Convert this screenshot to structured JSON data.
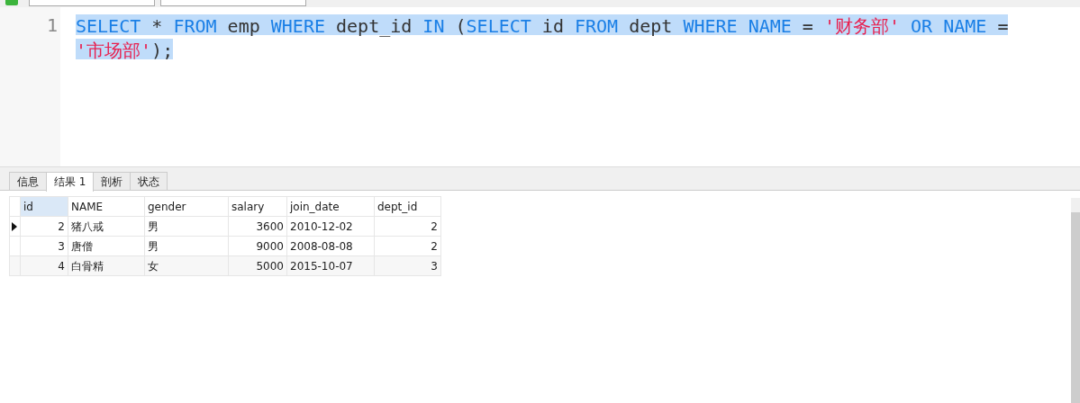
{
  "editor": {
    "lines": [
      {
        "number": "1",
        "selected": true,
        "tokens": [
          {
            "kind": "keyword",
            "text": "SELECT"
          },
          {
            "kind": "plain",
            "text": " * "
          },
          {
            "kind": "keyword",
            "text": "FROM"
          },
          {
            "kind": "plain",
            "text": " emp "
          },
          {
            "kind": "keyword",
            "text": "WHERE"
          },
          {
            "kind": "plain",
            "text": " dept_id "
          },
          {
            "kind": "keyword",
            "text": "IN"
          },
          {
            "kind": "plain",
            "text": " ("
          },
          {
            "kind": "keyword",
            "text": "SELECT"
          },
          {
            "kind": "plain",
            "text": " id "
          },
          {
            "kind": "keyword",
            "text": "FROM"
          },
          {
            "kind": "plain",
            "text": " dept "
          },
          {
            "kind": "keyword",
            "text": "WHERE NAME"
          },
          {
            "kind": "plain",
            "text": " = "
          },
          {
            "kind": "string",
            "text": "'财务部'"
          },
          {
            "kind": "keyword",
            "text": " OR NAME"
          },
          {
            "kind": "plain",
            "text": " ="
          }
        ]
      },
      {
        "selected": true,
        "tokens": [
          {
            "kind": "string",
            "text": "'市场部'"
          },
          {
            "kind": "plain",
            "text": ");"
          }
        ]
      }
    ]
  },
  "result_tabs": [
    {
      "label": "信息",
      "selected": false
    },
    {
      "label": "结果 1",
      "selected": true
    },
    {
      "label": "剖析",
      "selected": false
    },
    {
      "label": "状态",
      "selected": false
    }
  ],
  "table": {
    "columns": [
      {
        "label": "id",
        "numeric": true,
        "highlighted": true
      },
      {
        "label": "NAME",
        "numeric": false,
        "highlighted": false
      },
      {
        "label": "gender",
        "numeric": false,
        "highlighted": false
      },
      {
        "label": "salary",
        "numeric": true,
        "highlighted": false
      },
      {
        "label": "join_date",
        "numeric": false,
        "highlighted": false
      },
      {
        "label": "dept_id",
        "numeric": true,
        "highlighted": false
      }
    ],
    "rows": [
      {
        "current": true,
        "cells": [
          "2",
          "猪八戒",
          "男",
          "3600",
          "2010-12-02",
          "2"
        ]
      },
      {
        "current": false,
        "cells": [
          "3",
          "唐僧",
          "男",
          "9000",
          "2008-08-08",
          "2"
        ]
      },
      {
        "current": false,
        "cells": [
          "4",
          "白骨精",
          "女",
          "5000",
          "2015-10-07",
          "3"
        ]
      }
    ]
  }
}
